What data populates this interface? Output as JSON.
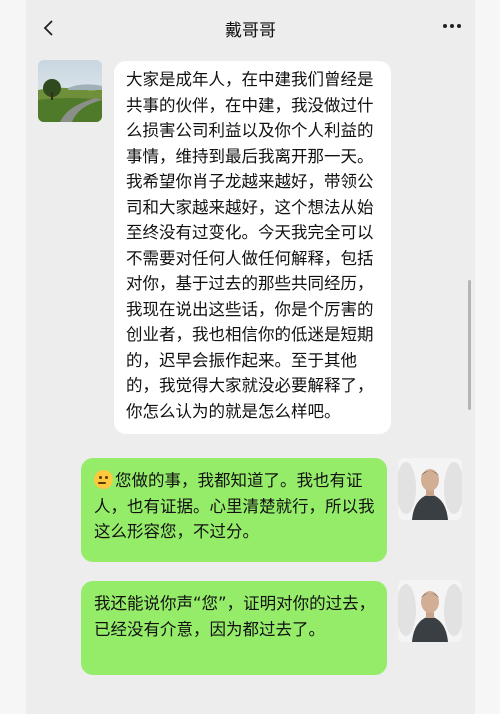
{
  "header": {
    "title": "戴哥哥",
    "back_icon": "chevron-left-icon",
    "more_icon": "more-dots-icon"
  },
  "messages": [
    {
      "side": "left",
      "text": "大家是成年人，在中建我们曾经是共事的伙伴，在中建，我没做过什么损害公司利益以及你个人利益的事情，维持到最后我离开那一天。我希望你肖子龙越来越好，带领公司和大家越来越好，这个想法从始至终没有过变化。今天我完全可以不需要对任何人做任何解释，包括对你，基于过去的那些共同经历，我现在说出这些话，你是个厉害的创业者，我也相信你的低迷是短期的，迟早会振作起来。至于其他的，我觉得大家就没必要解释了，你怎么认为的就是怎么样吧。"
    },
    {
      "side": "right",
      "emoji": "thinking-face-emoji",
      "text": "您做的事，我都知道了。我也有证人，也有证据。心里清楚就行，所以我这么形容您，不过分。"
    },
    {
      "side": "right",
      "text": "我还能说你声“您”，证明对你的过去，已经没有介意，因为都过去了。"
    }
  ],
  "colors": {
    "background": "#ededed",
    "incoming_bubble": "#ffffff",
    "outgoing_bubble": "#95ec69"
  }
}
